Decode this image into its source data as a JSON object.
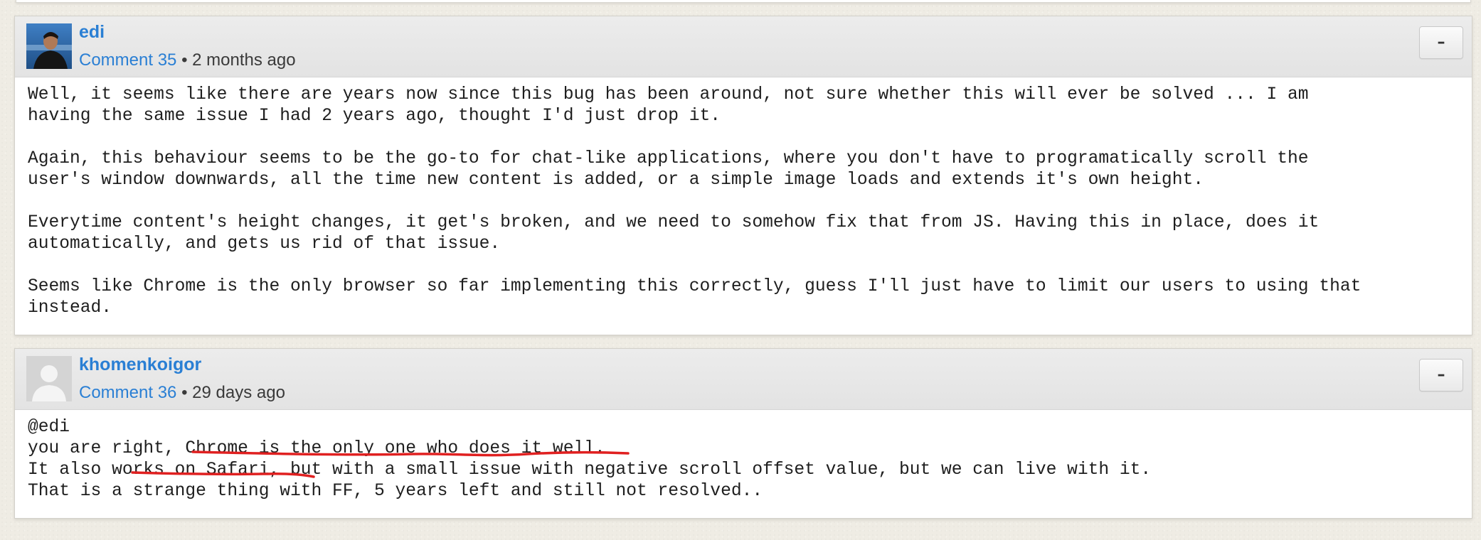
{
  "comments": [
    {
      "author": "edi",
      "comment_label": "Comment 35",
      "separator": "•",
      "age": "2 months ago",
      "collapse_label": "–",
      "paragraphs": [
        "Well, it seems like there are years now since this bug has been around, not sure whether this will ever be solved ... I am\nhaving the same issue I had 2 years ago, thought I'd just drop it.",
        "Again, this behaviour seems to be the go-to for chat-like applications, where you don't have to programatically scroll the\nuser's window downwards, all the time new content is added, or a simple image loads and extends it's own height.",
        "Everytime content's height changes, it get's broken, and we need to somehow fix that from JS. Having this in place, does it\nautomatically, and gets us rid of that issue.",
        "Seems like Chrome is the only browser so far implementing this correctly, guess I'll just have to limit our users to using that\ninstead."
      ]
    },
    {
      "author": "khomenkoigor",
      "comment_label": "Comment 36",
      "separator": "•",
      "age": "29 days ago",
      "collapse_label": "–",
      "lines": [
        "@edi",
        "you are right, Chrome is the only one who does it well.",
        "It also works on Safari, but with a small issue with negative scroll offset value, but we can live with it.",
        "That is a strange thing with FF, 5 years left and still not resolved.."
      ]
    }
  ],
  "annotation_color": "#e02020"
}
